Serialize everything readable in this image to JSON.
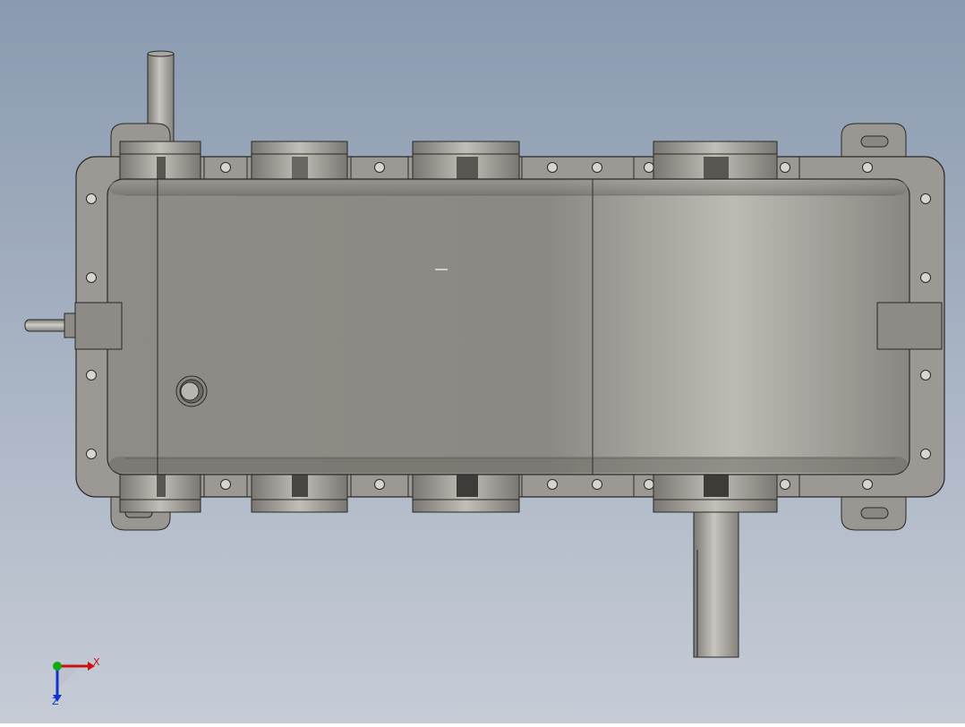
{
  "viewport": {
    "background_top": "#8a9ab0",
    "background_bottom": "#c6ccd6",
    "view": "top"
  },
  "model": {
    "description_colors": {
      "housing": "#8a8681",
      "housing_dark": "#6b6863",
      "flange": "#9c9893",
      "outline": "#2a2a2a",
      "shaft": "#a7a39e"
    }
  },
  "triad": {
    "x_label": "X",
    "z_label": "Z",
    "x_color": "#cc1111",
    "y_color": "#11aa11",
    "z_color": "#1133cc"
  }
}
